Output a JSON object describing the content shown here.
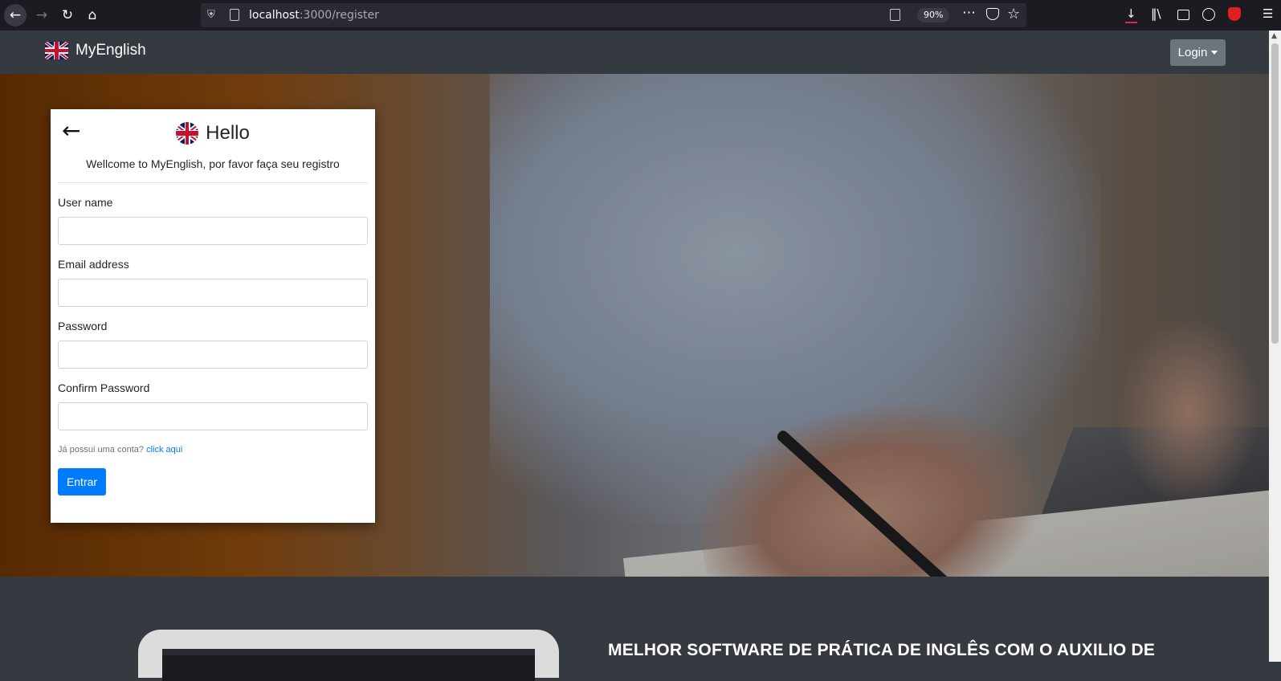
{
  "browser": {
    "url_host": "localhost",
    "url_path": ":3000/register",
    "zoom": "90%",
    "icons": [
      "back-arrow-icon",
      "forward-arrow-icon",
      "reload-icon",
      "home-icon",
      "shield-icon",
      "page-icon",
      "reader-view-icon",
      "more-dots-icon",
      "pocket-icon",
      "bookmark-star-icon",
      "download-icon",
      "library-icon",
      "sidebar-icon",
      "account-icon",
      "ublock-icon",
      "menu-icon"
    ]
  },
  "navbar": {
    "brand": "MyEnglish",
    "login_label": "Login"
  },
  "register_card": {
    "title": "Hello",
    "subtitle": "Wellcome to MyEnglish, por favor faça seu registro",
    "fields": {
      "username": {
        "label": "User name",
        "value": ""
      },
      "email": {
        "label": "Email address",
        "value": ""
      },
      "password": {
        "label": "Password",
        "value": ""
      },
      "confirm_password": {
        "label": "Confirm Password",
        "value": ""
      }
    },
    "account_prompt": "Já possui uma conta?",
    "account_link": "click aqui",
    "submit_label": "Entrar"
  },
  "lower_section": {
    "heading": "MELHOR SOFTWARE DE PRÁTICA DE INGLÊS COM O AUXILIO DE"
  },
  "colors": {
    "navbar_bg": "#343a40",
    "primary": "#007bff",
    "secondary": "#6c757d"
  }
}
